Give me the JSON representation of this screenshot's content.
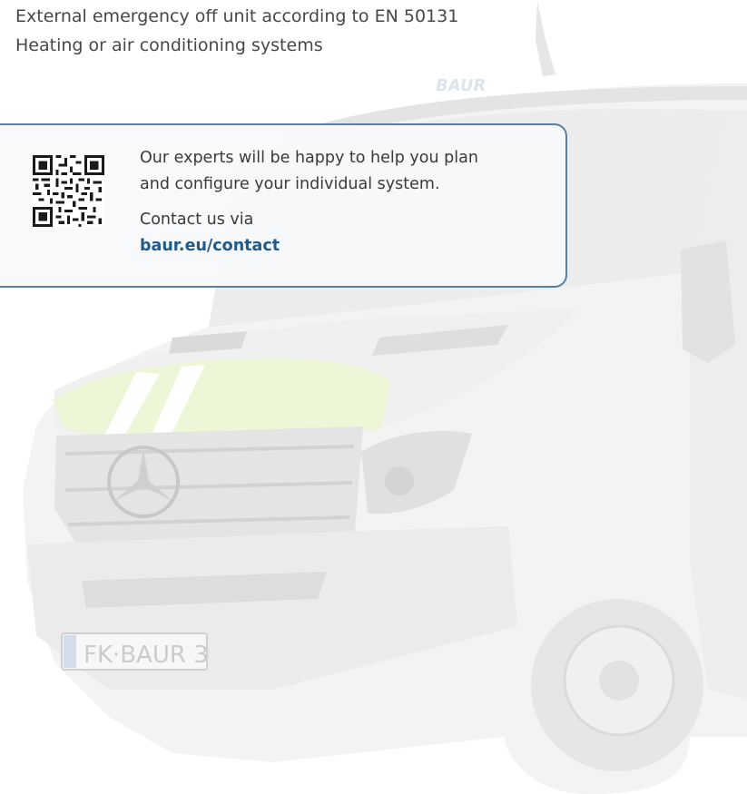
{
  "features": [
    "External emergency off unit according to EN 50131",
    "Heating or air conditioning systems"
  ],
  "contact_card": {
    "message_line1": "Our experts will be happy to help you plan",
    "message_line2": "and configure your individual system.",
    "contact_prefix": "Contact us via",
    "contact_link": "baur.eu/contact"
  },
  "background": {
    "vehicle_brand_logo": "BAUR",
    "license_plate": "FK BAUR 3",
    "accent_color": "#a4c938"
  },
  "colors": {
    "card_border": "#5a7fa3",
    "link": "#1e5a8c",
    "text": "#474747"
  }
}
